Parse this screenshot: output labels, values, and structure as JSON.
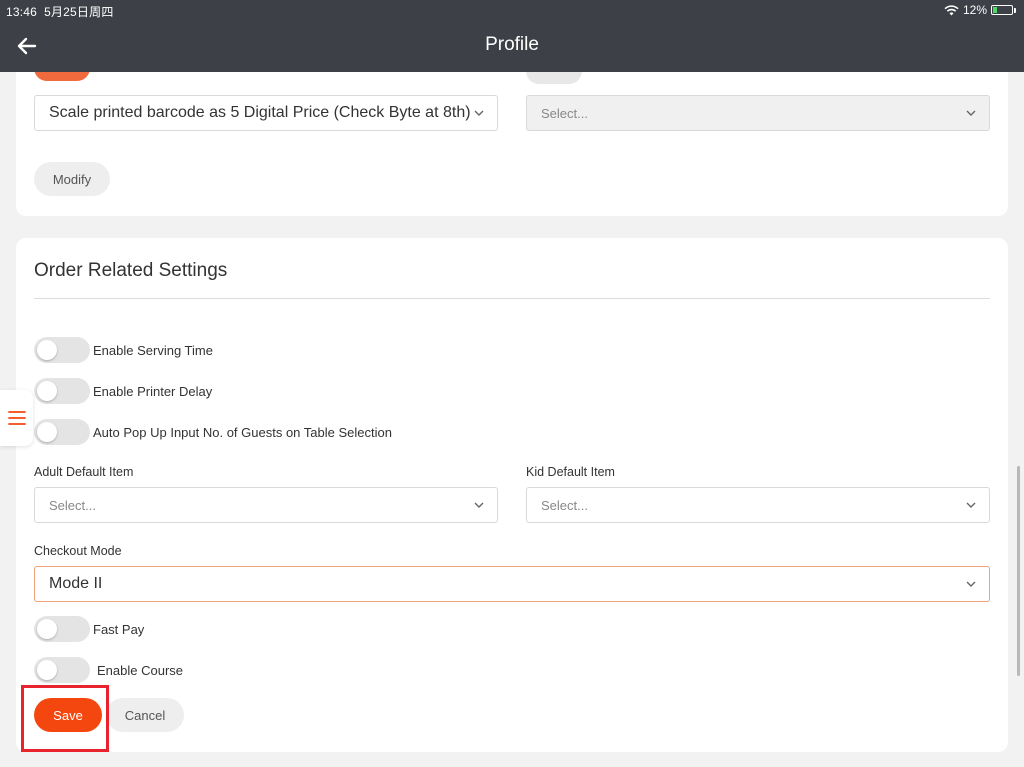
{
  "status_bar": {
    "time": "13:46",
    "date": "5月25日周四",
    "battery": "12%"
  },
  "header": {
    "title": "Profile",
    "back_icon": "arrow-left-icon"
  },
  "top_card": {
    "barcode_select_value": "Scale printed barcode as 5 Digital Price (Check Byte at 8th)",
    "right_select_placeholder": "Select...",
    "modify_label": "Modify"
  },
  "order_settings": {
    "title": "Order Related Settings",
    "toggles": [
      {
        "label": "Enable Serving Time",
        "on": false
      },
      {
        "label": "Enable Printer Delay",
        "on": false
      },
      {
        "label": "Auto Pop Up Input No. of Guests on Table Selection",
        "on": false
      }
    ],
    "adult_default_item": {
      "label": "Adult Default Item",
      "placeholder": "Select..."
    },
    "kid_default_item": {
      "label": "Kid Default Item",
      "placeholder": "Select..."
    },
    "checkout_mode": {
      "label": "Checkout Mode",
      "value": "Mode II"
    },
    "fast_pay": {
      "label": "Fast Pay",
      "on": false
    },
    "enable_course": {
      "label": "Enable Course",
      "on": false
    }
  },
  "actions": {
    "save_label": "Save",
    "cancel_label": "Cancel"
  },
  "colors": {
    "accent": "#f4470f",
    "header_bg": "#3d4046",
    "highlight": "#e8232d"
  }
}
